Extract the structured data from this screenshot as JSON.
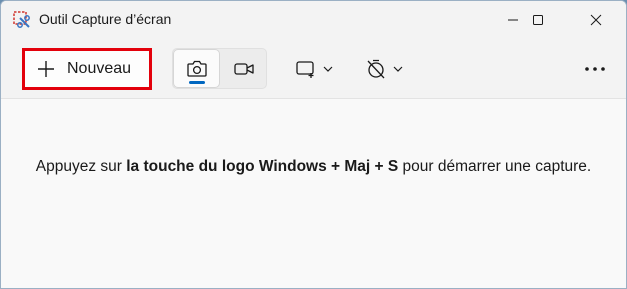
{
  "window": {
    "title": "Outil Capture d’écran",
    "controls": [
      "minimize",
      "maximize",
      "close"
    ]
  },
  "toolbar": {
    "new_label": "Nouveau",
    "new_icon": "plus-icon",
    "modes": [
      {
        "name": "photo",
        "icon": "camera-icon",
        "selected": true
      },
      {
        "name": "video",
        "icon": "video-camera-icon",
        "selected": false
      }
    ],
    "shape_dropdown_icon": "rectangle-snip-icon",
    "delay_dropdown_icon": "no-timer-icon",
    "more_icon": "ellipsis-icon",
    "highlight_color": "#e3000b",
    "accent_color": "#0067c0"
  },
  "content": {
    "hint_prefix": "Appuyez sur ",
    "hint_bold": "la touche du logo Windows + Maj + S",
    "hint_suffix": " pour démarrer une capture."
  }
}
